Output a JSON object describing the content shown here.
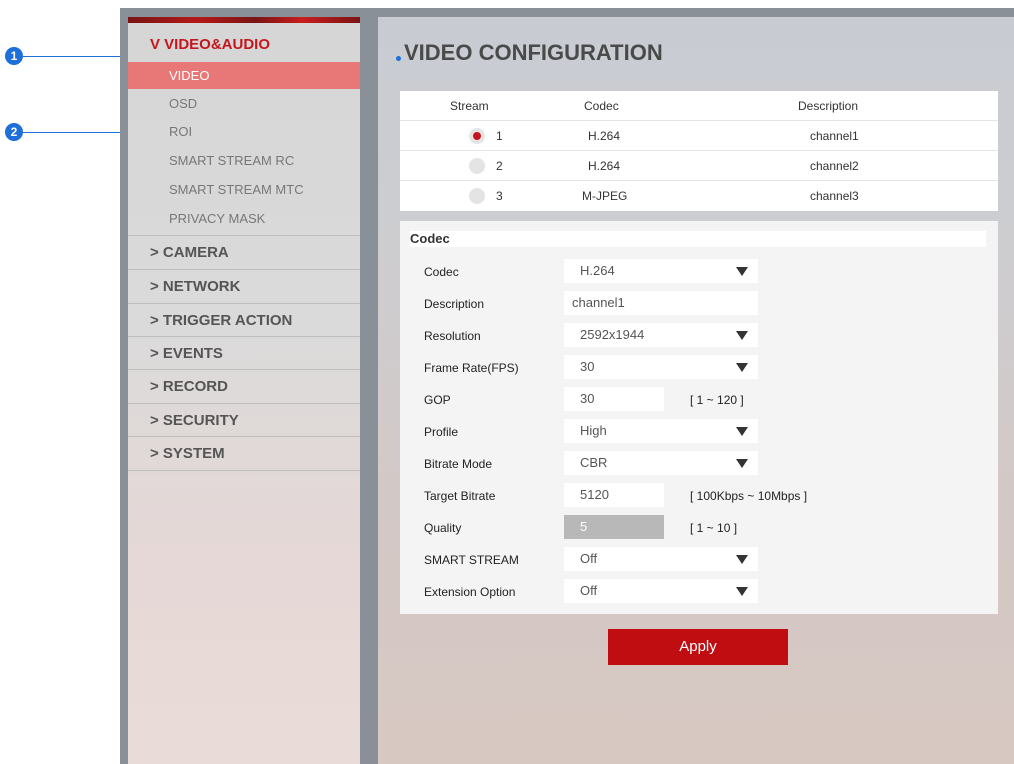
{
  "callouts": {
    "one": "1",
    "two": "2"
  },
  "sidebar": {
    "group_active": "V VIDEO&AUDIO",
    "sub_items": [
      "VIDEO",
      "OSD",
      "ROI",
      "SMART STREAM RC",
      "SMART STREAM MTC",
      "PRIVACY MASK"
    ],
    "menu": [
      "> CAMERA",
      "> NETWORK",
      "> TRIGGER ACTION",
      "> EVENTS",
      "> RECORD",
      "> SECURITY",
      "> SYSTEM"
    ]
  },
  "main": {
    "title": "VIDEO CONFIGURATION"
  },
  "stream_table": {
    "headers": {
      "stream": "Stream",
      "codec": "Codec",
      "description": "Description"
    },
    "rows": [
      {
        "stream": "1",
        "codec": "H.264",
        "description": "channel1",
        "selected": true
      },
      {
        "stream": "2",
        "codec": "H.264",
        "description": "channel2",
        "selected": false
      },
      {
        "stream": "3",
        "codec": "M-JPEG",
        "description": "channel3",
        "selected": false
      }
    ]
  },
  "codec_form": {
    "heading": "Codec",
    "fields": {
      "codec": {
        "label": "Codec",
        "value": "H.264"
      },
      "description": {
        "label": "Description",
        "value": "channel1"
      },
      "resolution": {
        "label": "Resolution",
        "value": "2592x1944"
      },
      "frame_rate": {
        "label": "Frame Rate(FPS)",
        "value": "30"
      },
      "gop": {
        "label": "GOP",
        "value": "30",
        "hint": "[ 1 ~ 120 ]"
      },
      "profile": {
        "label": "Profile",
        "value": "High"
      },
      "bitrate_mode": {
        "label": "Bitrate Mode",
        "value": "CBR"
      },
      "target_bitrate": {
        "label": "Target Bitrate",
        "value": "5120",
        "hint": "[ 100Kbps ~ 10Mbps ]"
      },
      "quality": {
        "label": "Quality",
        "value": "5",
        "hint": "[ 1 ~ 10 ]"
      },
      "smart_stream": {
        "label": "SMART STREAM",
        "value": "Off"
      },
      "extension_option": {
        "label": "Extension Option",
        "value": "Off"
      }
    }
  },
  "apply_label": "Apply",
  "colors": {
    "accent": "#c4161c",
    "callout": "#1e6fd9",
    "active_item": "#e87878"
  }
}
